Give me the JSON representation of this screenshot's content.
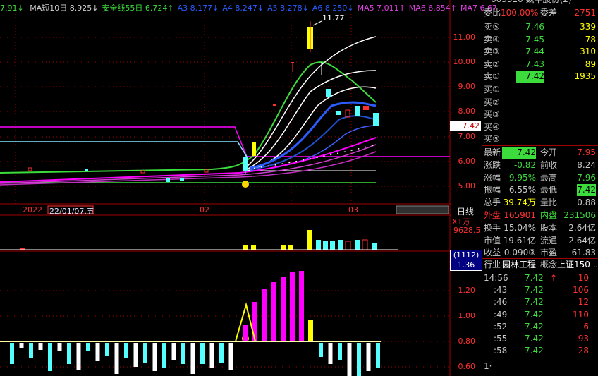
{
  "header": {
    "partial_left": "7.91↓",
    "ma_items": [
      {
        "text": "MA短10日 8.925↓",
        "color": "#d0d0d0"
      },
      {
        "text": "安全线55日 6.724↑",
        "color": "#3cdc3c"
      },
      {
        "text": "A3 8.177↓",
        "color": "#2a5cff"
      },
      {
        "text": "A4 8.247↓",
        "color": "#2a5cff"
      },
      {
        "text": "A5 8.278↓",
        "color": "#2a5cff"
      },
      {
        "text": "A6 8.250↓",
        "color": "#2a5cff"
      },
      {
        "text": "MA5 7.011↑",
        "color": "#e040e0"
      },
      {
        "text": "MA6 6.854↑",
        "color": "#e040e0"
      },
      {
        "text": "MA7 6.67",
        "color": "#e040e0"
      }
    ],
    "top_partial": "603310 巍华股份(2)"
  },
  "price_axis": [
    "11.00",
    "10.00",
    "9.00",
    "8.00",
    "7.00",
    "6.00",
    "5.00"
  ],
  "high_label": "11.77",
  "current_price_tag": "7.42",
  "date_axis": {
    "year": "2022",
    "cursor_date": "22/01/07.五",
    "m02": "02",
    "m03": "03",
    "period_button": "日线"
  },
  "volume_panel": {
    "unit": "X1万",
    "max_label": "9628.5",
    "box_top": "(1112)",
    "box_bottom": "1.36"
  },
  "indicator_axis": [
    "1.20",
    "1.00",
    "0.80",
    "0.60"
  ],
  "order_book": {
    "wb_label": "委比",
    "wb_value": "100.00%",
    "wc_label": "委差",
    "wc_value": "-2751",
    "asks": [
      {
        "label": "卖⑤",
        "price": "7.46",
        "vol": "339"
      },
      {
        "label": "卖④",
        "price": "7.45",
        "vol": "78"
      },
      {
        "label": "卖③",
        "price": "7.44",
        "vol": "310"
      },
      {
        "label": "卖②",
        "price": "7.43",
        "vol": "89"
      },
      {
        "label": "卖①",
        "price": "7.42",
        "vol": "1935"
      }
    ],
    "bids": [
      "买①",
      "买②",
      "买③",
      "买④",
      "买⑤"
    ]
  },
  "quote": [
    {
      "l1": "最新",
      "v1": "7.42",
      "l2": "今开",
      "v2": "7.95"
    },
    {
      "l1": "涨跌",
      "v1": "-0.82",
      "l2": "前收",
      "v2": "8.24"
    },
    {
      "l1": "涨幅",
      "v1": "-9.95%",
      "l2": "最高",
      "v2": "7.96"
    },
    {
      "l1": "振幅",
      "v1": "6.55%",
      "l2": "最低",
      "v2": "7.42"
    },
    {
      "l1": "总手",
      "v1": "39.74万",
      "l2": "量比",
      "v2": "0.88"
    },
    {
      "l1": "外盘",
      "v1": "165901",
      "l2": "内盘",
      "v2": "231506"
    },
    {
      "l1": "换手",
      "v1": "15.04%",
      "l2": "股本",
      "v2": "2.64亿"
    },
    {
      "l1": "市值",
      "v1": "19.61亿",
      "l2": "流通",
      "v2": "2.64亿"
    },
    {
      "l1": "收益",
      "v1": "0.090③",
      "l2": "市盈",
      "v2": "61.83"
    }
  ],
  "industry": {
    "l1": "行业",
    "v1": "园林工程",
    "l2": "概念",
    "v2": "上证150 ..."
  },
  "ticks": [
    {
      "t": "14:56",
      "p": "7.42",
      "v": "10",
      "arrow": "↑"
    },
    {
      "t": ":43",
      "p": "7.42",
      "v": "106",
      "arrow": ""
    },
    {
      "t": ":46",
      "p": "7.42",
      "v": "12",
      "arrow": ""
    },
    {
      "t": ":49",
      "p": "7.42",
      "v": "110",
      "arrow": ""
    },
    {
      "t": ":52",
      "p": "7.42",
      "v": "6",
      "arrow": ""
    },
    {
      "t": ":55",
      "p": "7.42",
      "v": "93",
      "arrow": ""
    },
    {
      "t": ":58",
      "p": "7.42",
      "v": "28",
      "arrow": ""
    }
  ],
  "colors": {
    "up": "#ff3030",
    "down": "#54ffff",
    "grid": "#a00000",
    "label": "#c8c8c8",
    "price": "#3cdc3c",
    "yellow": "#ffff00",
    "magenta": "#ff00ff"
  }
}
